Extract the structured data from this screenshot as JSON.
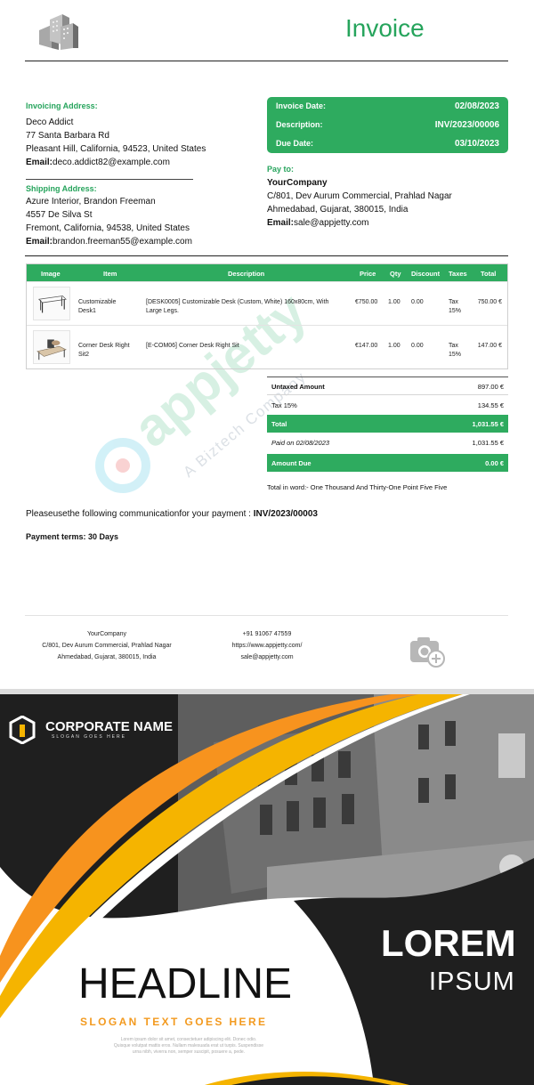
{
  "invoice": {
    "title": "Invoice",
    "invoicing_address": {
      "heading": "Invoicing Address:",
      "name": "Deco Addict",
      "street": "77 Santa Barbara Rd",
      "city": "Pleasant Hill, California, 94523, United States",
      "email_label": "Email:",
      "email": "deco.addict82@example.com"
    },
    "shipping_address": {
      "heading": "Shipping Address:",
      "name": "Azure Interior,  Brandon Freeman",
      "street": "4557 De Silva St",
      "city": "Fremont, California, 94538, United States",
      "email_label": "Email:",
      "email": "brandon.freeman55@example.com"
    },
    "info_box": {
      "date_label": "Invoice Date:",
      "date": "02/08/2023",
      "desc_label": "Description:",
      "desc": "INV/2023/00006",
      "due_label": "Due Date:",
      "due": "03/10/2023"
    },
    "pay_to": {
      "heading": "Pay to:",
      "company": "YourCompany",
      "line1": "C/801, Dev Aurum Commercial, Prahlad Nagar",
      "line2": "Ahmedabad, Gujarat, 380015, India",
      "email_label": "Email:",
      "email": "sale@appjetty.com"
    },
    "table": {
      "headers": [
        "Image",
        "Item",
        "Description",
        "Price",
        "Qty",
        "Discount",
        "Taxes",
        "Total"
      ],
      "rows": [
        {
          "item_l1": "Customizable",
          "item_l2": "Desk1",
          "desc_l1": "[DESK0005] Customizable Desk (Custom, White) 160x80cm, With",
          "desc_l2": "Large Legs.",
          "price": "€750.00",
          "qty": "1.00",
          "discount": "0.00",
          "tax_l1": "Tax",
          "tax_l2": "15%",
          "total": "750.00 €"
        },
        {
          "item_l1": "Corner Desk Right",
          "item_l2": "Sit2",
          "desc_l1": "[E-COM06] Corner Desk Right Sit",
          "desc_l2": "",
          "price": "€147.00",
          "qty": "1.00",
          "discount": "0.00",
          "tax_l1": "Tax",
          "tax_l2": "15%",
          "total": "147.00 €"
        }
      ]
    },
    "totals": {
      "untaxed_label": "Untaxed Amount",
      "untaxed": "897.00 €",
      "tax_label": "Tax 15%",
      "tax": "134.55 €",
      "total_label": "Total",
      "total": "1,031.55 €",
      "paid_label": "Paid on 02/08/2023",
      "paid": "1,031.55 €",
      "due_label": "Amount Due",
      "due": "0.00 €"
    },
    "total_in_words": "Total in word:- One Thousand And Thirty-One Point Five Five",
    "communication_prefix": "Pleaseusethe following communicationfor your payment : ",
    "communication_ref": "INV/2023/00003",
    "payment_terms": "Payment terms: 30 Days",
    "watermark": {
      "brand": "appjetty",
      "tagline": "A Biztech Company"
    },
    "footer": {
      "company": "YourCompany",
      "address1": "C/801, Dev Aurum Commercial, Prahlad Nagar",
      "address2": "Ahmedabad, Gujarat, 380015, India",
      "phone": "+91 91067 47559",
      "website": "https://www.appjetty.com/",
      "email": "sale@appjetty.com"
    }
  },
  "banner": {
    "corporate_name": "CORPORATE NAME",
    "corporate_slogan": "SLOGAN GOES HERE",
    "lorem": "LOREM",
    "ipsum": "IPSUM",
    "headline": "HEADLINE",
    "slogan": "SLOGAN TEXT GOES HERE",
    "body_l1": "Lorem ipsum dolor sit amet, consectetuer adipiscing elit. Donec odio.",
    "body_l2": "Quisque volutpat mattis eros. Nullam malesuada erat ut turpis. Suspendisse",
    "body_l3": "urna nibh, viverra non, semper suscipit, posuere a, pede.",
    "colors": {
      "orange": "#f7931e",
      "yellow": "#f5b400",
      "dark": "#222222",
      "green": "#2eab5f"
    }
  }
}
